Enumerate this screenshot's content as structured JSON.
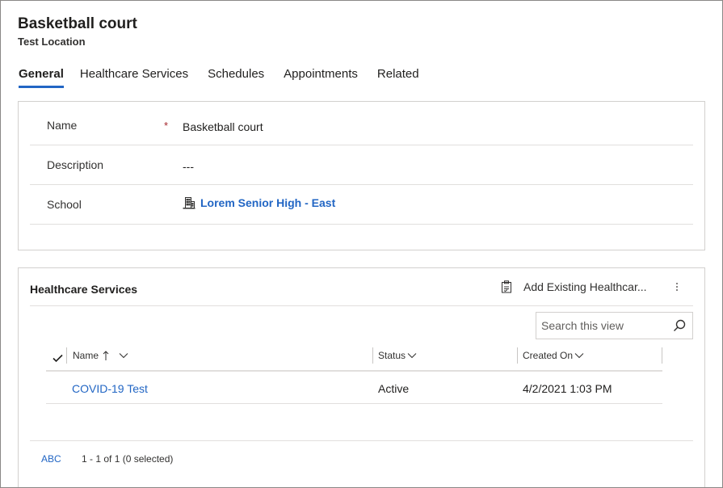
{
  "header": {
    "title": "Basketball court",
    "subtitle": "Test Location"
  },
  "tabs": [
    {
      "label": "General",
      "active": true
    },
    {
      "label": "Healthcare Services",
      "active": false
    },
    {
      "label": "Schedules",
      "active": false
    },
    {
      "label": "Appointments",
      "active": false
    },
    {
      "label": "Related",
      "active": false
    }
  ],
  "form": {
    "name": {
      "label": "Name",
      "required_marker": "*",
      "value": "Basketball court"
    },
    "description": {
      "label": "Description",
      "value": "---"
    },
    "school": {
      "label": "School",
      "value": "Lorem Senior High - East",
      "icon": "building-icon"
    }
  },
  "subgrid": {
    "title": "Healthcare Services",
    "add_existing_label": "Add Existing Healthcar...",
    "search_placeholder": "Search this view",
    "columns": [
      {
        "label": "Name",
        "sort": "ascending"
      },
      {
        "label": "Status"
      },
      {
        "label": "Created On"
      }
    ],
    "rows": [
      {
        "name": "COVID-19 Test",
        "status": "Active",
        "created_on": "4/2/2021 1:03 PM"
      }
    ],
    "footer": {
      "jump_bar": "ABC",
      "record_count": "1 - 1 of 1 (0 selected)"
    }
  },
  "colors": {
    "accent": "#2266c4",
    "required": "#a4262c",
    "border": "#d2d0ce"
  }
}
